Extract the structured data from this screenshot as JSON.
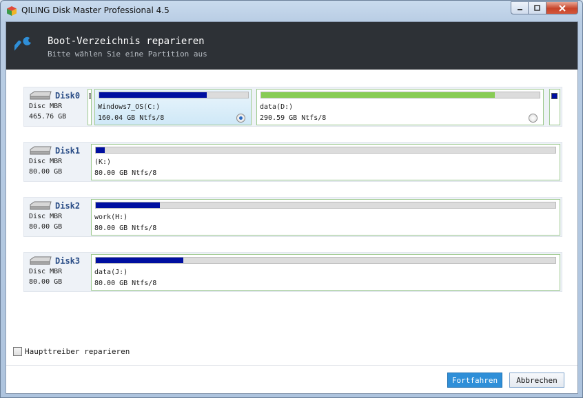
{
  "window": {
    "title": "QILING Disk Master Professional 4.5"
  },
  "header": {
    "title": "Boot-Verzeichnis reparieren",
    "subtitle": "Bitte wählen Sie eine Partition aus"
  },
  "disks": [
    {
      "name": "Disk0",
      "type": "Disc MBR",
      "size": "465.76 GB",
      "partitions": [
        {
          "label": "Windows7_OS(C:)",
          "detail": "160.04 GB Ntfs/8",
          "used_fraction": 0.72,
          "selected": true,
          "fill_color": "#000fa0"
        },
        {
          "label": "data(D:)",
          "detail": "290.59 GB Ntfs/8",
          "used_fraction": 0.84,
          "selected": false,
          "fill_color": "#88cc55"
        }
      ]
    },
    {
      "name": "Disk1",
      "type": "Disc MBR",
      "size": "80.00 GB",
      "partitions": [
        {
          "label": "(K:)",
          "detail": "80.00 GB Ntfs/8",
          "used_fraction": 0.02
        }
      ]
    },
    {
      "name": "Disk2",
      "type": "Disc MBR",
      "size": "80.00 GB",
      "partitions": [
        {
          "label": "work(H:)",
          "detail": "80.00 GB Ntfs/8",
          "used_fraction": 0.14
        }
      ]
    },
    {
      "name": "Disk3",
      "type": "Disc MBR",
      "size": "80.00 GB",
      "partitions": [
        {
          "label": "data(J:)",
          "detail": "80.00 GB Ntfs/8",
          "used_fraction": 0.19
        }
      ]
    }
  ],
  "options": {
    "checkbox_label": "Haupttreiber reparieren",
    "checked": false
  },
  "buttons": {
    "continue": "Fortfahren",
    "cancel": "Abbrechen"
  },
  "colors": {
    "accent": "#2f8fd8",
    "header_bg": "#2d3136",
    "used_blue": "#000fa0",
    "used_green": "#88cc55",
    "border_green": "#9dc98e"
  }
}
